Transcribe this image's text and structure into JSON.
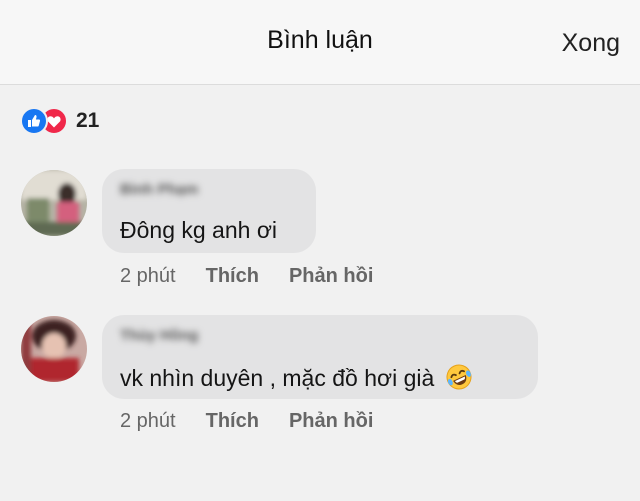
{
  "header": {
    "title": "Bình luận",
    "done_label": "Xong"
  },
  "reactions": {
    "count": "21",
    "icons": [
      "like-icon",
      "love-icon"
    ]
  },
  "comments": [
    {
      "author": "Bình Phạm",
      "text": "Đông kg anh ơi",
      "time": "2 phút",
      "like_label": "Thích",
      "reply_label": "Phản hồi"
    },
    {
      "author": "Thùy Hồng",
      "text": "vk nhìn duyên , mặc đồ hơi già",
      "emoji": "rolling-on-floor-laughing",
      "time": "2 phút",
      "like_label": "Thích",
      "reply_label": "Phản hồi"
    }
  ],
  "colors": {
    "like": "#1877f2",
    "love": "#f0284a",
    "bubble": "#e3e3e4"
  }
}
